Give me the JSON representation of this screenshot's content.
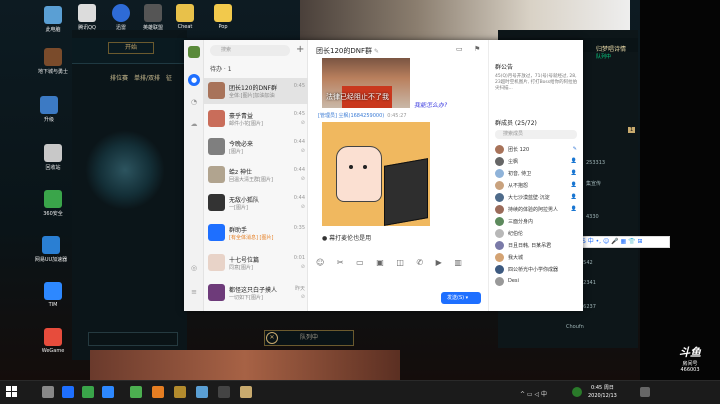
{
  "desktop": {
    "icons": [
      {
        "label": "此电脑"
      },
      {
        "label": "地下城与勇士"
      },
      {
        "label": "升级"
      },
      {
        "label": "回收站"
      },
      {
        "label": "360安全"
      },
      {
        "label": "网易UU加速器"
      },
      {
        "label": "TIM"
      },
      {
        "label": "WeGame"
      }
    ],
    "top_icons": [
      {
        "label": "腾讯QQ"
      },
      {
        "label": "迅雷"
      },
      {
        "label": "英雄联盟"
      },
      {
        "label": "Cheat"
      },
      {
        "label": "Pop"
      }
    ]
  },
  "game": {
    "tab_label": "开始",
    "nav_items": [
      "排位赛",
      "单排/双排",
      "征"
    ],
    "queue_label": "队列中",
    "right_name": "归梦唱诗情",
    "right_status": "队列中",
    "right_number": "1",
    "friends": [
      "253313",
      "集宣传",
      "4330",
      "5542",
      "12341",
      "26237",
      "Choufn"
    ]
  },
  "qq": {
    "search_placeholder": "搜索",
    "todo_label": "待办 · 1",
    "conversations": [
      {
        "name": "团长120的DNF群",
        "msg": "全体:[图片]加油加油",
        "time": "0:45",
        "muted": ""
      },
      {
        "name": "豪乎青益",
        "msg": "邮件小花[图片]",
        "time": "0:45",
        "muted": "⊘"
      },
      {
        "name": "今晚必来",
        "msg": "[图片]",
        "time": "0:44",
        "muted": "⊘"
      },
      {
        "name": "蛤z 神仕",
        "msg": "回温大清王群[图片]",
        "time": "0:44",
        "muted": "⊘"
      },
      {
        "name": "无敌小狐队",
        "msg": "一[图片]",
        "time": "0:44",
        "muted": "⊘"
      },
      {
        "name": "群助手",
        "msg": "[有全体消息] [图片]",
        "time": "0:35",
        "muted": ""
      },
      {
        "name": "十七号位篇",
        "msg": "同意[图片]",
        "time": "0:01",
        "muted": "⊘"
      },
      {
        "name": "都怪这只白子摸人",
        "msg": "一切如下[图片]",
        "time": "昨天",
        "muted": "⊘"
      }
    ],
    "chat": {
      "title": "团长120的DNF群",
      "image1_caption": "法律已经阻止不了我",
      "image1_side": "我能怎么办?",
      "admin_tag": "[管理员] 尘枫(1684259000)",
      "admin_time": "0:45:27",
      "message": "● 幕打麦伦也是用",
      "toolbar": "☺ ✂ ▭ ▣ ◫ ✆ ▶ ▥",
      "send_label": "发送(S) ▾"
    },
    "panel": {
      "notice_title": "群公告",
      "notice_text": "45(Q)月号开放过，71(号)号就经过, 28, 23超时空机图片, 打打Boss给你的阿拉伯尖扫描...",
      "members_title": "群成员 (25/72)",
      "member_search": "搜索成员",
      "members": [
        {
          "name": "团长 120",
          "role": "✎"
        },
        {
          "name": "尘枫",
          "role": "👤"
        },
        {
          "name": "初音, 侍卫",
          "role": "👤"
        },
        {
          "name": "从不抱怨",
          "role": "👤"
        },
        {
          "name": "大七沙漠蓝壁·沉淀",
          "role": "👤"
        },
        {
          "name": "持续的体验的阿拉男人",
          "role": "👤"
        },
        {
          "name": "三面分身内",
          "role": ""
        },
        {
          "name": "纪伯伦",
          "role": ""
        },
        {
          "name": "日且日韩, 日某吊君",
          "role": ""
        },
        {
          "name": "我大城",
          "role": ""
        },
        {
          "name": "四公桥光中小学你成器",
          "role": ""
        },
        {
          "name": "Desi",
          "role": ""
        }
      ]
    }
  },
  "ime": {
    "label": "S 中 •, ☺ 🎤 ▦ 👕 ⊞"
  },
  "watermark": {
    "logo": "斗鱼",
    "sub": "房间号",
    "room": "466003"
  },
  "taskbar": {
    "time": "0:45 周日",
    "date": "2020/12/13",
    "tray": "^ ▭ ◁ 中"
  },
  "colors": {
    "accent": "#1e6fff",
    "lol_gold": "#c8aa6e",
    "taskbar": "#1b1b1b"
  }
}
